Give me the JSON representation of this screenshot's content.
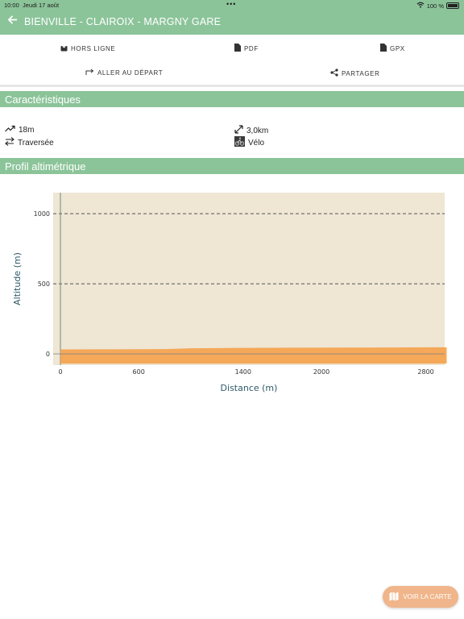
{
  "status_bar": {
    "time": "10:00",
    "date": "Jeudi 17 août",
    "battery": "100 %"
  },
  "header": {
    "title": "BIENVILLE - CLAIROIX - MARGNY GARE",
    "back_icon": "arrow-left-icon"
  },
  "actions": {
    "offline": "HORS LIGNE",
    "pdf": "PDF",
    "gpx": "GPX",
    "go_start": "ALLER AU DÉPART",
    "share": "PARTAGER"
  },
  "characteristics": {
    "title": "Caractéristiques",
    "elevation": "18m",
    "distance": "3,0km",
    "route_type": "Traversée",
    "activity": "Vélo"
  },
  "profile": {
    "title": "Profil altimétrique"
  },
  "chart_data": {
    "type": "area",
    "xlabel": "Distance (m)",
    "ylabel": "Altitude (m)",
    "xticks": [
      "0",
      "600",
      "1400",
      "2000",
      "2800"
    ],
    "yticks": [
      "0",
      "500",
      "1000"
    ],
    "xlim": [
      0,
      3000
    ],
    "ylim": [
      -80,
      1150
    ],
    "grid": "horizontal dashed",
    "x": [
      0,
      400,
      800,
      1000,
      1400,
      1800,
      2200,
      2600,
      2960
    ],
    "y": [
      32,
      33,
      34,
      40,
      43,
      44,
      45,
      46,
      47
    ]
  },
  "fab": {
    "label": "VOIR LA CARTE"
  },
  "colors": {
    "accent": "#8cc49a",
    "fill": "#f4a14a",
    "plot_bg": "#efe6d4",
    "fab": "#f0b58a"
  }
}
